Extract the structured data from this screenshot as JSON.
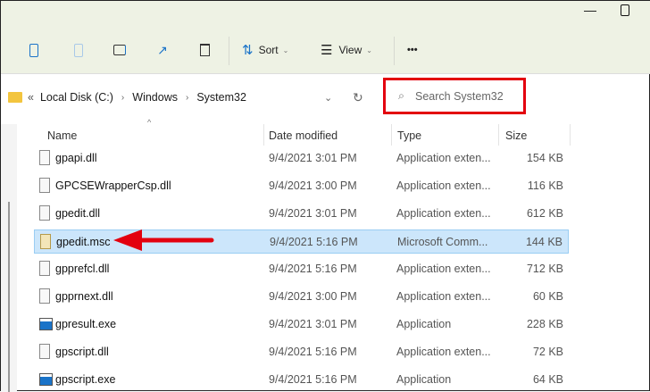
{
  "window": {
    "minimize_icon": "minimize-icon",
    "maximize_icon": "maximize-icon"
  },
  "toolbar": {
    "sort_label": "Sort",
    "view_label": "View",
    "more_label": "•••"
  },
  "address": {
    "parts": [
      "Local Disk (C:)",
      "Windows",
      "System32"
    ],
    "overflow": "«"
  },
  "search": {
    "placeholder": "Search System32"
  },
  "columns": {
    "name": "Name",
    "date": "Date modified",
    "type": "Type",
    "size": "Size"
  },
  "files": [
    {
      "name": "gpapi.dll",
      "date": "9/4/2021 3:01 PM",
      "type": "Application exten...",
      "size": "154 KB",
      "icon": "dll"
    },
    {
      "name": "GPCSEWrapperCsp.dll",
      "date": "9/4/2021 3:00 PM",
      "type": "Application exten...",
      "size": "116 KB",
      "icon": "dll"
    },
    {
      "name": "gpedit.dll",
      "date": "9/4/2021 3:01 PM",
      "type": "Application exten...",
      "size": "612 KB",
      "icon": "dll"
    },
    {
      "name": "gpedit.msc",
      "date": "9/4/2021 5:16 PM",
      "type": "Microsoft Comm...",
      "size": "144 KB",
      "icon": "msc",
      "selected": true
    },
    {
      "name": "gpprefcl.dll",
      "date": "9/4/2021 5:16 PM",
      "type": "Application exten...",
      "size": "712 KB",
      "icon": "dll"
    },
    {
      "name": "gpprnext.dll",
      "date": "9/4/2021 3:00 PM",
      "type": "Application exten...",
      "size": "60 KB",
      "icon": "dll"
    },
    {
      "name": "gpresult.exe",
      "date": "9/4/2021 3:01 PM",
      "type": "Application",
      "size": "228 KB",
      "icon": "exe"
    },
    {
      "name": "gpscript.dll",
      "date": "9/4/2021 5:16 PM",
      "type": "Application exten...",
      "size": "72 KB",
      "icon": "dll"
    },
    {
      "name": "gpscript.exe",
      "date": "9/4/2021 5:16 PM",
      "type": "Application",
      "size": "64 KB",
      "icon": "exe"
    }
  ],
  "colors": {
    "highlight": "#e3000f",
    "selection": "#cce6fb",
    "accent": "#1a73c8"
  }
}
